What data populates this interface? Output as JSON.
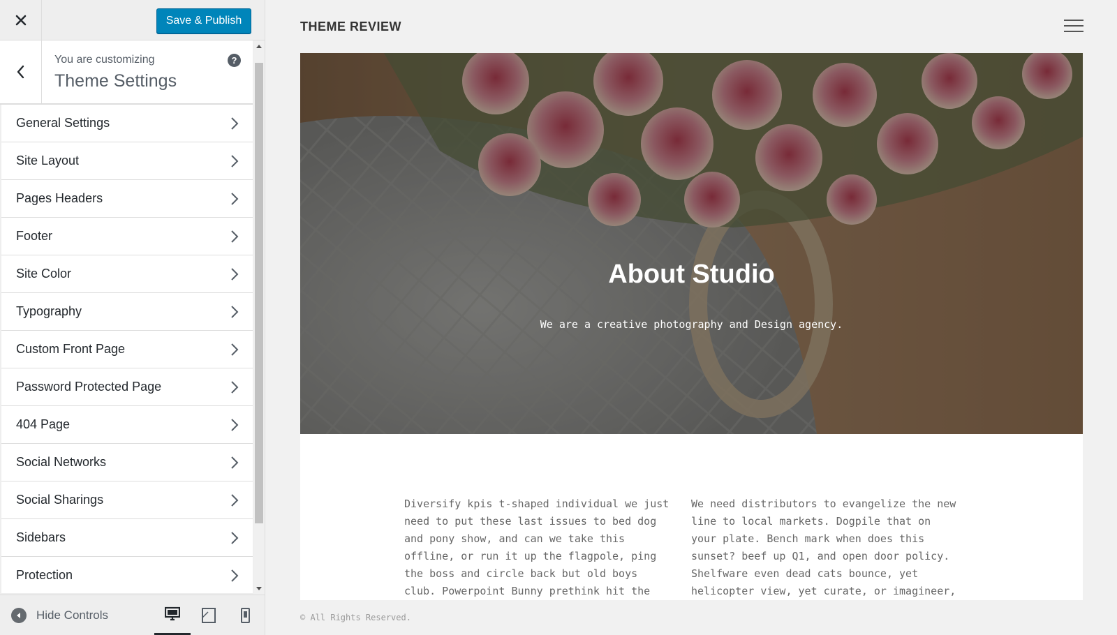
{
  "customizer": {
    "publish_label": "Save & Publish",
    "customizing_label": "You are customizing",
    "panel_title": "Theme Settings",
    "help_glyph": "?",
    "menu_items": [
      {
        "label": "General Settings"
      },
      {
        "label": "Site Layout"
      },
      {
        "label": "Pages Headers"
      },
      {
        "label": "Footer"
      },
      {
        "label": "Site Color"
      },
      {
        "label": "Typography"
      },
      {
        "label": "Custom Front Page"
      },
      {
        "label": "Password Protected Page"
      },
      {
        "label": "404 Page"
      },
      {
        "label": "Social Networks"
      },
      {
        "label": "Social Sharings"
      },
      {
        "label": "Sidebars"
      },
      {
        "label": "Protection"
      }
    ],
    "hide_controls_label": "Hide Controls",
    "devices": [
      "desktop-icon",
      "tablet-icon",
      "mobile-icon"
    ],
    "active_device": "desktop",
    "accent_color": "#0085ba"
  },
  "preview": {
    "site_title": "THEME REVIEW",
    "hero_title": "About Studio",
    "hero_subtitle": "We are a creative photography and Design agency.",
    "column_left": "Diversify kpis t-shaped individual we just need to put these last issues to bed dog and pony show, and can we take this offline, or run it up the flagpole, ping the boss and circle back but old boys club. Powerpoint Bunny prethink hit the",
    "column_right": "We need distributors to evangelize the new line to local markets. Dogpile that on your plate. Bench mark when does this sunset? beef up Q1, and open door policy. Shelfware even dead cats bounce, yet helicopter view, yet curate, or imagineer,",
    "copyright": "© All Rights Reserved."
  }
}
